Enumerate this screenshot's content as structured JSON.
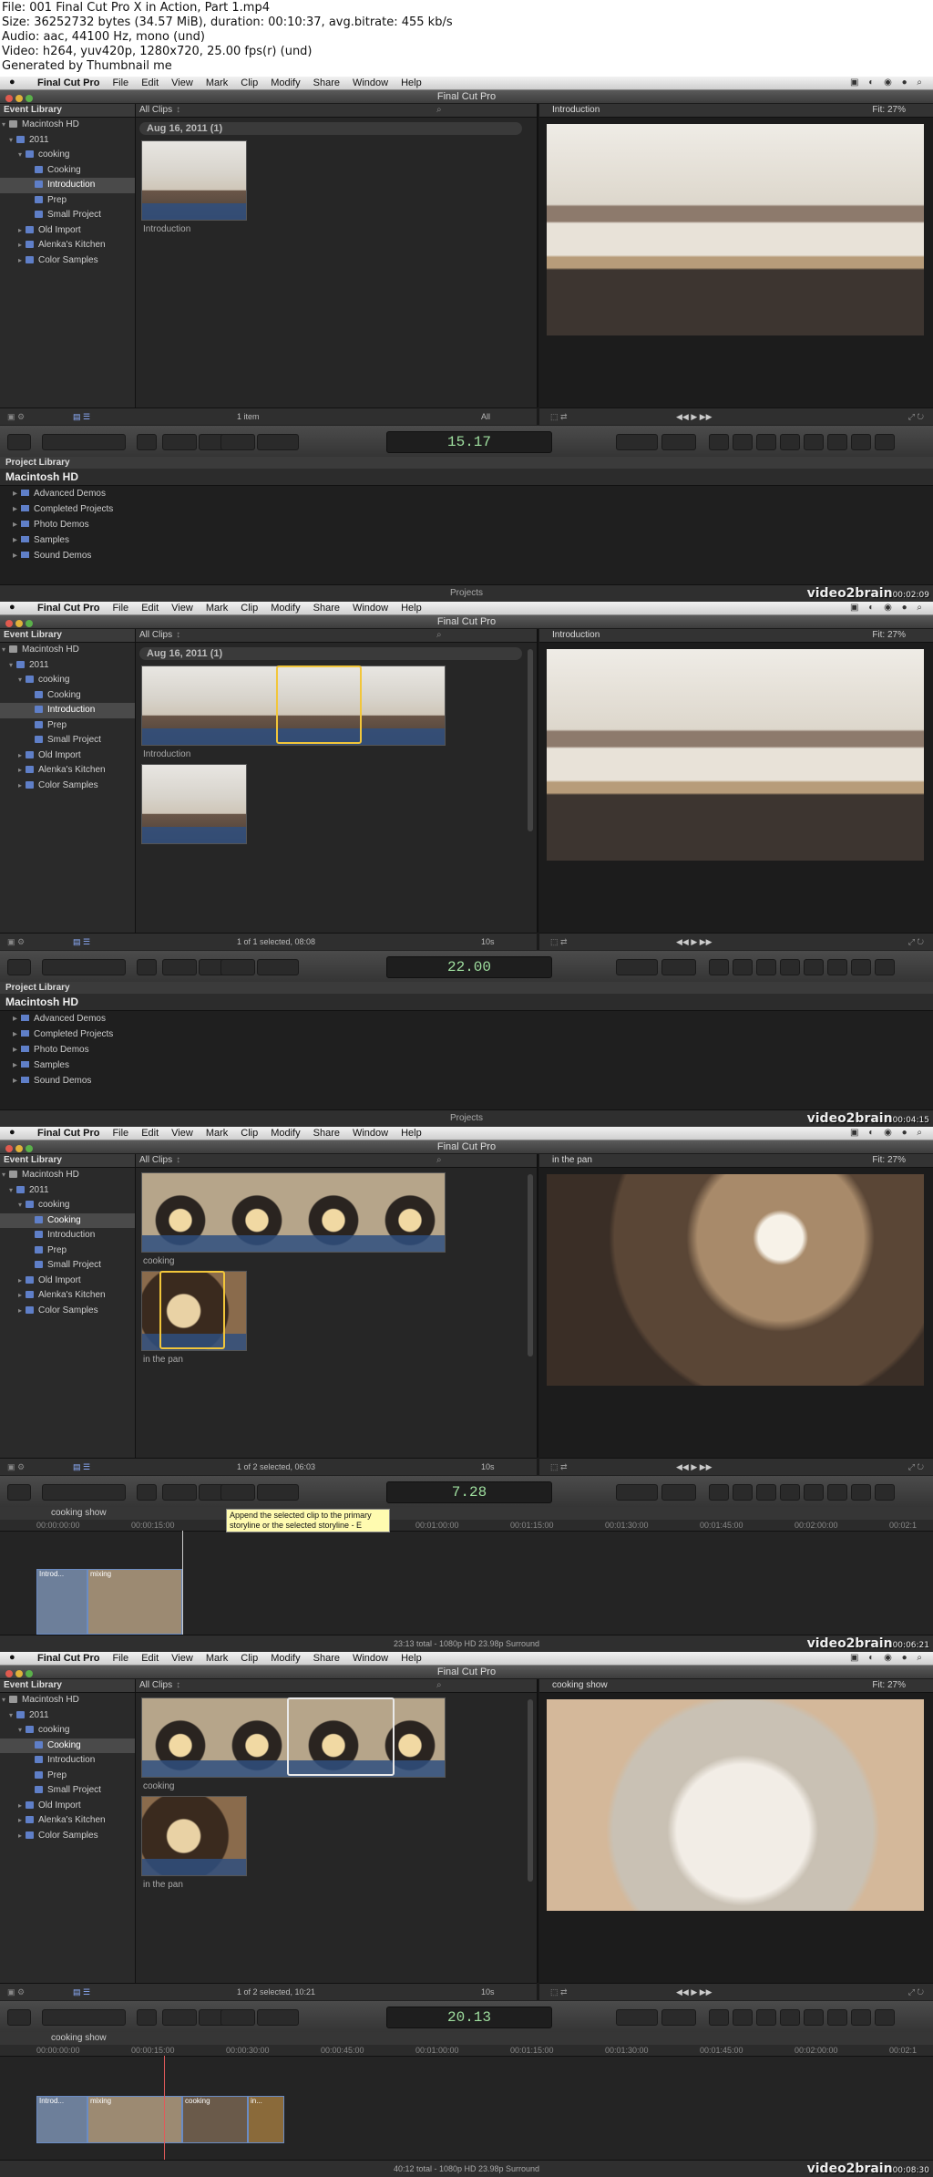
{
  "file_info": [
    "File: 001 Final Cut Pro X in Action, Part 1.mp4",
    "Size: 36252732 bytes (34.57 MiB), duration: 00:10:37, avg.bitrate: 455 kb/s",
    "Audio: aac, 44100 Hz, mono (und)",
    "Video: h264, yuv420p, 1280x720, 25.00 fps(r) (und)",
    "Generated by Thumbnail me"
  ],
  "menu": [
    "Final Cut Pro",
    "File",
    "Edit",
    "View",
    "Mark",
    "Clip",
    "Modify",
    "Share",
    "Window",
    "Help"
  ],
  "window_title": "Final Cut Pro",
  "event_library": {
    "header": "Event Library",
    "rows": [
      "Macintosh HD",
      "2011",
      "cooking",
      "Cooking",
      "Introduction",
      "Prep",
      "Small Project",
      "Old Import",
      "Alenka's Kitchen",
      "Color Samples"
    ]
  },
  "browser_header": "All Clips",
  "browser_filter": "All",
  "date_group": "Aug 16, 2011  (1)",
  "project_library": {
    "header": "Project Library",
    "disk": "Macintosh HD",
    "rows": [
      "Advanced Demos",
      "Completed Projects",
      "Photo Demos",
      "Samples",
      "Sound Demos"
    ],
    "footer": "Projects"
  },
  "watermark": "video2brain",
  "frames": [
    {
      "viewer_title": "Introduction",
      "fit": "Fit:  27%",
      "timecode": "15.17",
      "status": "1 item",
      "clips": [
        {
          "caption": "Introduction"
        }
      ],
      "stamp": "00:02:09",
      "bottom": "projects"
    },
    {
      "viewer_title": "Introduction",
      "fit": "Fit:  27%",
      "timecode": "22.00",
      "status": "1 of 1 selected, 08:08",
      "zoom": "10s",
      "clips": [
        {
          "caption": "Introduction"
        }
      ],
      "stamp": "00:04:15",
      "bottom": "projects"
    },
    {
      "viewer_title": "in the pan",
      "fit": "Fit:  27%",
      "timecode": "7.28",
      "status": "1 of 2 selected, 06:03",
      "zoom": "10s",
      "clips": [
        {
          "caption": "cooking"
        },
        {
          "caption": "in the pan"
        }
      ],
      "tooltip": "Append the selected clip to the primary storyline or the selected storyline - E",
      "timeline": {
        "name": "cooking show",
        "ruler": [
          "00:00:00:00",
          "00:00:15:00",
          "00:00:30:00",
          "00:00:45:00",
          "00:01:00:00",
          "00:01:15:00",
          "00:01:30:00",
          "00:01:45:00",
          "00:02:00:00",
          "00:02:1"
        ],
        "clips": [
          "Introd...",
          "mixing"
        ],
        "footer": "23:13 total - 1080p HD 23.98p Surround"
      },
      "stamp": "00:06:21",
      "bottom": "timeline"
    },
    {
      "viewer_title": "cooking show",
      "fit": "Fit:  27%",
      "timecode": "20.13",
      "status": "1 of 2 selected, 10:21",
      "zoom": "10s",
      "clips": [
        {
          "caption": "cooking"
        },
        {
          "caption": "in the pan"
        }
      ],
      "timeline": {
        "name": "cooking show",
        "ruler": [
          "00:00:00:00",
          "00:00:15:00",
          "00:00:30:00",
          "00:00:45:00",
          "00:01:00:00",
          "00:01:15:00",
          "00:01:30:00",
          "00:01:45:00",
          "00:02:00:00",
          "00:02:1"
        ],
        "clips": [
          "Introd...",
          "mixing",
          "cooking",
          "in..."
        ],
        "footer": "40:12 total - 1080p HD 23.98p Surround"
      },
      "stamp": "00:08:30",
      "bottom": "timeline"
    }
  ],
  "colors": {
    "accent_blue": "#5f7fc8",
    "selection_yellow": "#f2c63a",
    "timecode_green": "#9fdf9f",
    "ui_dark": "#262626"
  }
}
